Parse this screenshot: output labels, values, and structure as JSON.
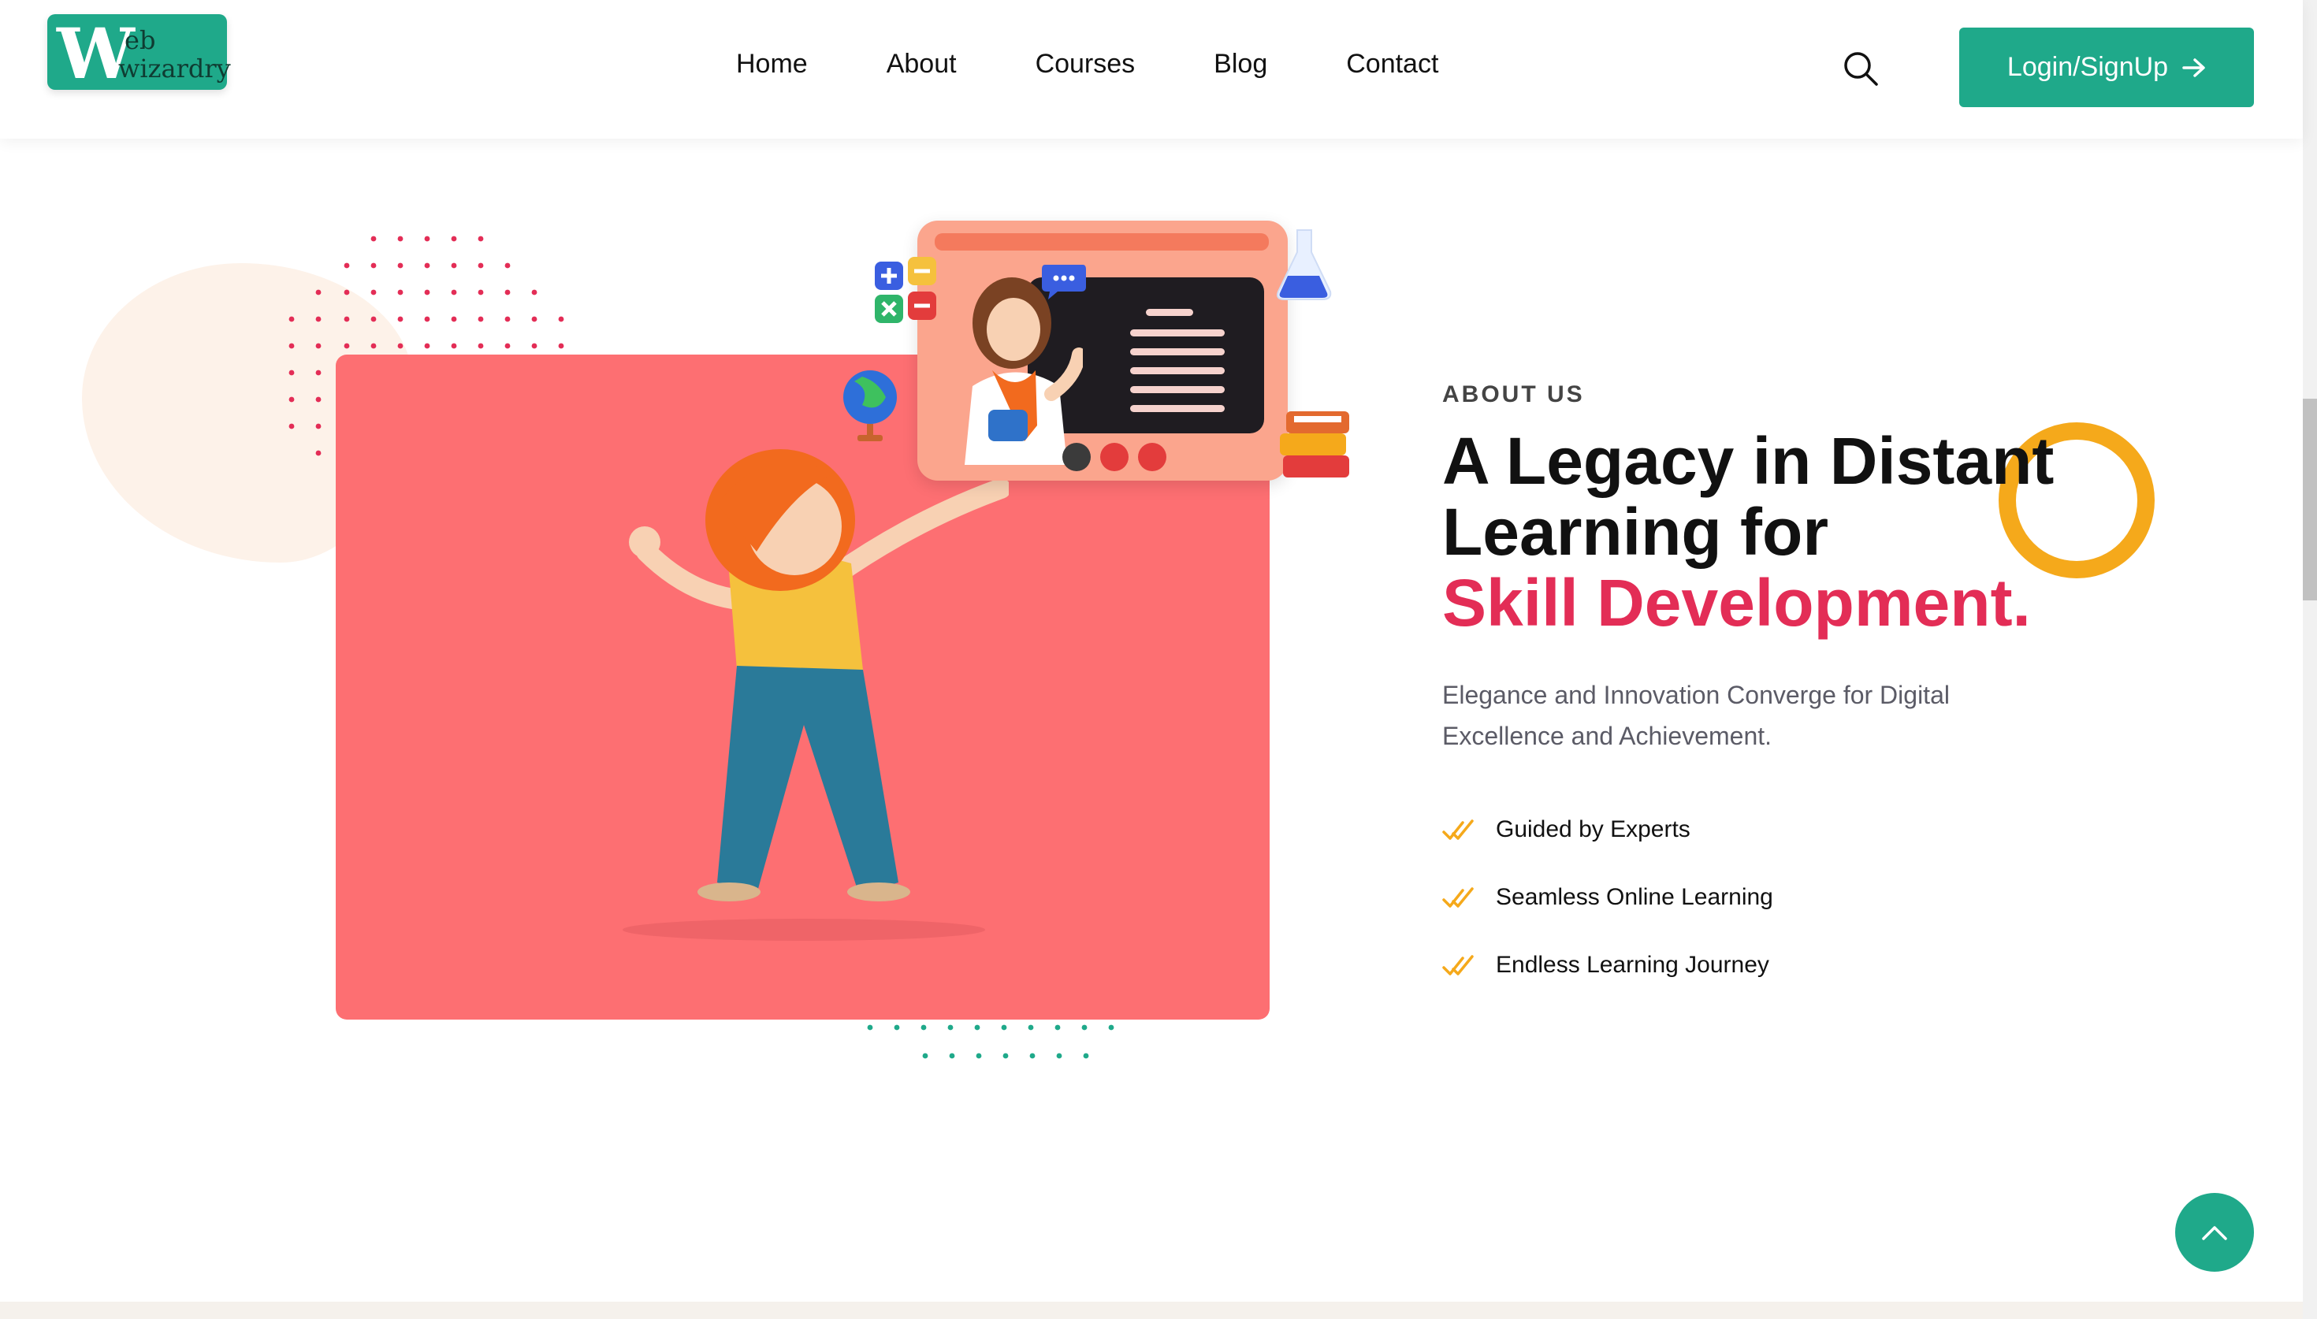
{
  "header": {
    "logo": {
      "big_letter": "W",
      "line1": "eb",
      "line2": "wizardry"
    },
    "nav": [
      "Home",
      "About",
      "Courses",
      "Blog",
      "Contact"
    ],
    "search_icon": "search-icon",
    "login_label": "Login/SignUp",
    "login_icon": "arrow-right-icon"
  },
  "hero": {
    "eyebrow": "ABOUT US",
    "title_line1": "A Legacy in Distant",
    "title_line2": "Learning for",
    "title_accent": "Skill Development.",
    "description": "Elegance and Innovation Converge for Digital Excellence and Achievement.",
    "features": [
      "Guided by Experts",
      "Seamless Online Learning",
      "Endless Learning Journey"
    ],
    "feature_icon": "double-check-icon"
  },
  "colors": {
    "brand": "#1fa98a",
    "accent": "#e32d56",
    "ring": "#f5a91b",
    "card": "#fd6f72"
  },
  "scroll_top_icon": "chevron-up-icon"
}
